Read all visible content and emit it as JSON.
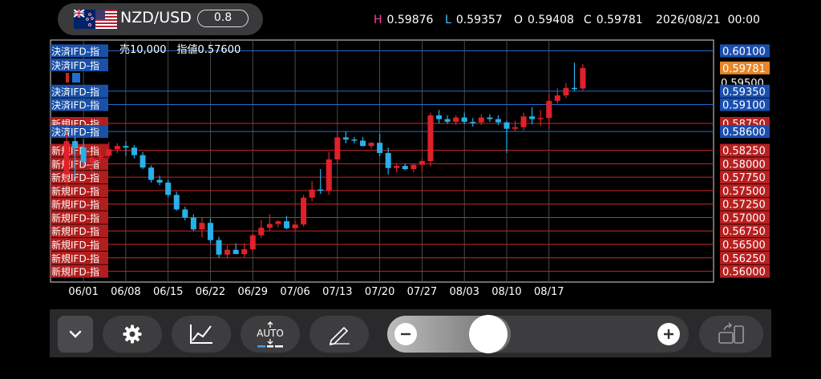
{
  "header": {
    "pair": "NZD/USD",
    "spread": "0.8",
    "ohlc": [
      {
        "key": "H",
        "value": "0.59876",
        "color": "#ff3fa0"
      },
      {
        "key": "L",
        "value": "0.59357",
        "color": "#3cc8ff"
      },
      {
        "key": "O",
        "value": "0.59408",
        "color": "#ffffff"
      },
      {
        "key": "C",
        "value": "0.59781",
        "color": "#ffffff"
      }
    ],
    "datetime": "2026/08/21  00:00"
  },
  "chart": {
    "pending_note": "売10,000　指値0.57600",
    "x_labels": [
      "06/01",
      "06/08",
      "06/15",
      "06/22",
      "06/29",
      "07/06",
      "07/13",
      "07/20",
      "07/27",
      "08/03",
      "08/10",
      "08/17"
    ],
    "current_price": "0.59781",
    "axis_label_top": "0.59500",
    "settle_label": "決済IFD-指",
    "new_label": "新規IFD-指",
    "settle_orders": [
      "0.60100",
      "0.59350",
      "0.59100",
      "0.58600"
    ],
    "new_orders": [
      "0.58750",
      "0.58250",
      "0.58000",
      "0.57750",
      "0.57500",
      "0.57250",
      "0.57000",
      "0.56750",
      "0.56500",
      "0.56250",
      "0.56000"
    ],
    "colors": {
      "up": "#e0202a",
      "down": "#29b0e8",
      "settle": "#1f6fd0",
      "new": "#c82828",
      "current": "#e8862a"
    }
  },
  "chart_data": {
    "type": "candlestick",
    "ylim": [
      0.558,
      0.603
    ],
    "x": [
      "05/28",
      "05/29",
      "06/01",
      "06/02",
      "06/03",
      "06/04",
      "06/05",
      "06/08",
      "06/09",
      "06/10",
      "06/11",
      "06/12",
      "06/15",
      "06/16",
      "06/17",
      "06/18",
      "06/19",
      "06/22",
      "06/23",
      "06/24",
      "06/25",
      "06/26",
      "06/29",
      "06/30",
      "07/01",
      "07/02",
      "07/03",
      "07/06",
      "07/07",
      "07/08",
      "07/09",
      "07/10",
      "07/13",
      "07/14",
      "07/15",
      "07/16",
      "07/17",
      "07/20",
      "07/21",
      "07/22",
      "07/23",
      "07/24",
      "07/27",
      "07/28",
      "07/29",
      "07/30",
      "07/31",
      "08/03",
      "08/04",
      "08/05",
      "08/06",
      "08/07",
      "08/10",
      "08/11",
      "08/12",
      "08/13",
      "08/14",
      "08/17",
      "08/18",
      "08/19",
      "08/20",
      "08/21"
    ],
    "open": [
      0.578,
      0.5842,
      0.583,
      0.5803,
      0.5812,
      0.5815,
      0.5827,
      0.5833,
      0.583,
      0.5816,
      0.5793,
      0.577,
      0.5765,
      0.5742,
      0.5715,
      0.57,
      0.5678,
      0.569,
      0.5658,
      0.5631,
      0.564,
      0.5632,
      0.5641,
      0.5667,
      0.5681,
      0.5688,
      0.5693,
      0.568,
      0.5687,
      0.5737,
      0.5752,
      0.575,
      0.5808,
      0.5849,
      0.5845,
      0.5843,
      0.5833,
      0.5839,
      0.582,
      0.5792,
      0.5796,
      0.579,
      0.5798,
      0.5805,
      0.589,
      0.5883,
      0.5878,
      0.5886,
      0.5878,
      0.5877,
      0.5886,
      0.5883,
      0.5877,
      0.5865,
      0.5868,
      0.5888,
      0.5883,
      0.5885,
      0.5917,
      0.5927,
      0.5941,
      0.594
    ],
    "high": [
      0.586,
      0.585,
      0.5845,
      0.5815,
      0.5825,
      0.584,
      0.5838,
      0.5842,
      0.5835,
      0.5822,
      0.5797,
      0.5778,
      0.577,
      0.5748,
      0.572,
      0.5706,
      0.57,
      0.5698,
      0.5664,
      0.5648,
      0.5652,
      0.5652,
      0.567,
      0.5695,
      0.5706,
      0.5695,
      0.5703,
      0.5694,
      0.5742,
      0.5768,
      0.579,
      0.5822,
      0.586,
      0.586,
      0.585,
      0.585,
      0.584,
      0.5856,
      0.583,
      0.58,
      0.58,
      0.58,
      0.581,
      0.5895,
      0.59,
      0.589,
      0.589,
      0.5895,
      0.5885,
      0.5892,
      0.5892,
      0.589,
      0.588,
      0.588,
      0.5895,
      0.5905,
      0.59,
      0.593,
      0.594,
      0.595,
      0.5988,
      0.5985
    ],
    "low": [
      0.576,
      0.5775,
      0.5795,
      0.578,
      0.5803,
      0.581,
      0.582,
      0.5815,
      0.581,
      0.579,
      0.5765,
      0.576,
      0.5738,
      0.5713,
      0.5695,
      0.5675,
      0.5663,
      0.5652,
      0.5625,
      0.5624,
      0.5632,
      0.5626,
      0.5637,
      0.5662,
      0.5675,
      0.5682,
      0.5678,
      0.5675,
      0.5683,
      0.573,
      0.5744,
      0.5742,
      0.58,
      0.5838,
      0.5838,
      0.5832,
      0.5828,
      0.5814,
      0.578,
      0.5784,
      0.5788,
      0.5784,
      0.5785,
      0.5795,
      0.5875,
      0.5874,
      0.5872,
      0.5874,
      0.5869,
      0.5872,
      0.5878,
      0.5872,
      0.582,
      0.586,
      0.5862,
      0.5873,
      0.587,
      0.5865,
      0.5912,
      0.5922,
      0.5935,
      0.5936
    ],
    "close": [
      0.5842,
      0.583,
      0.5803,
      0.5812,
      0.5815,
      0.5827,
      0.5833,
      0.583,
      0.5816,
      0.5793,
      0.577,
      0.5765,
      0.5742,
      0.5715,
      0.57,
      0.5678,
      0.569,
      0.5658,
      0.5631,
      0.564,
      0.5632,
      0.5641,
      0.5667,
      0.5681,
      0.5688,
      0.5693,
      0.568,
      0.5687,
      0.5737,
      0.5752,
      0.575,
      0.5808,
      0.5849,
      0.5845,
      0.5843,
      0.5833,
      0.5839,
      0.582,
      0.5792,
      0.5796,
      0.579,
      0.5798,
      0.5805,
      0.589,
      0.5883,
      0.5878,
      0.5886,
      0.5878,
      0.5877,
      0.5886,
      0.5883,
      0.5877,
      0.5865,
      0.5868,
      0.5888,
      0.5883,
      0.5885,
      0.5917,
      0.5927,
      0.5941,
      0.594,
      0.5978
    ]
  },
  "toolbar": {
    "auto_label": "AUTO",
    "icons": [
      "chevron-down-icon",
      "gear-icon",
      "line-chart-icon",
      "auto-scale-icon",
      "pencil-icon",
      "minus-icon",
      "plus-icon",
      "layout-icon"
    ]
  }
}
